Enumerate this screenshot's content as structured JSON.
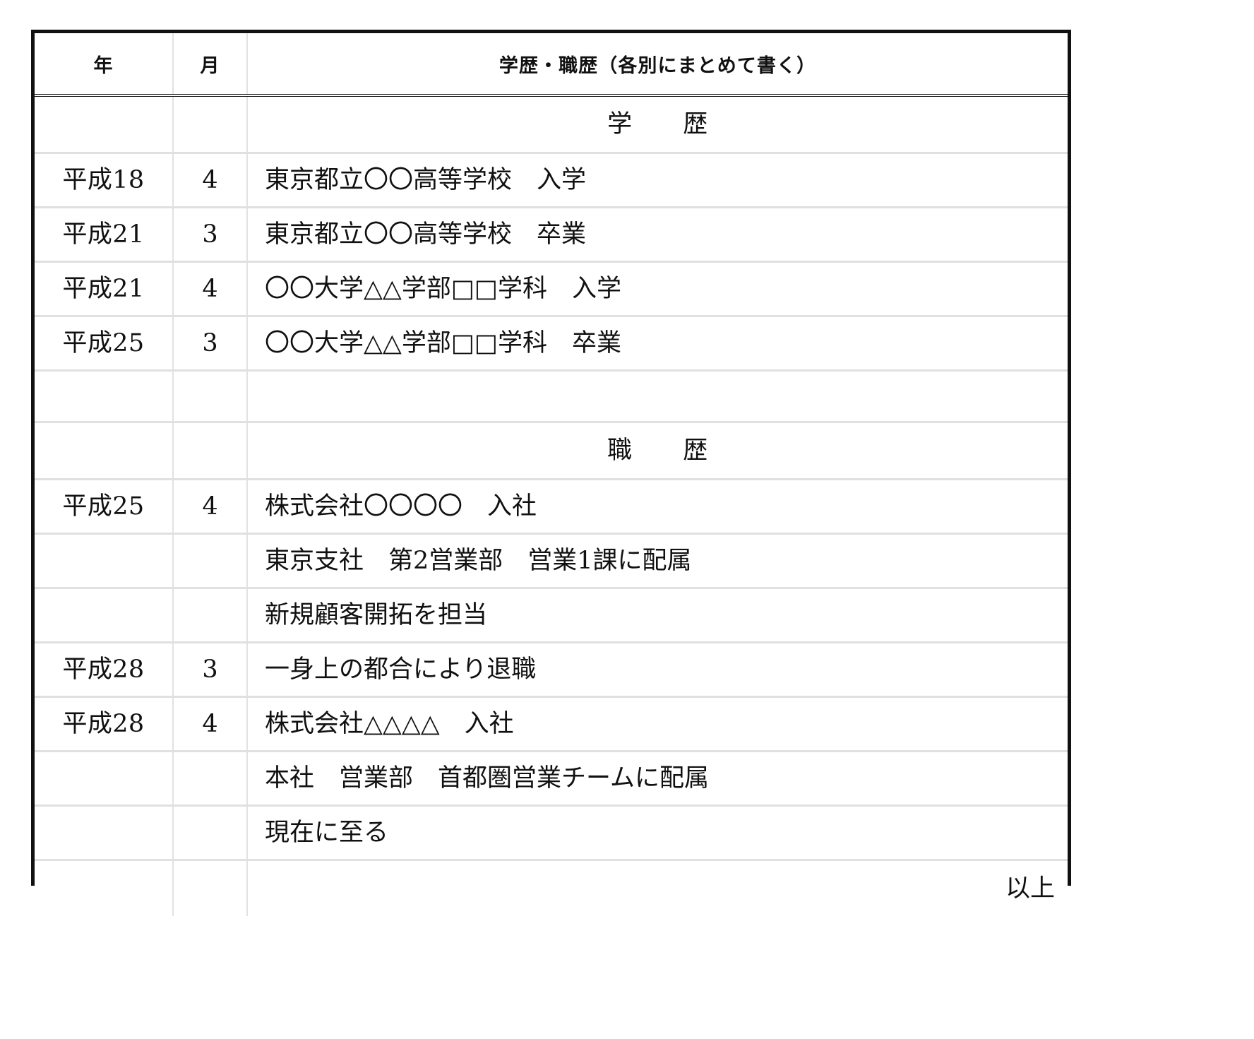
{
  "document": {
    "kind": "japanese-resume-history-table"
  },
  "table": {
    "headers": {
      "year": "年",
      "month": "月",
      "content": "学歴・職歴（各別にまとめて書く）"
    },
    "rows": [
      {
        "year": "",
        "month": "",
        "content": "学　　歴",
        "align": "center"
      },
      {
        "year": "平成18",
        "month": "4",
        "content": "東京都立〇〇高等学校　入学",
        "align": "left"
      },
      {
        "year": "平成21",
        "month": "3",
        "content": "東京都立〇〇高等学校　卒業",
        "align": "left"
      },
      {
        "year": "平成21",
        "month": "4",
        "content": "〇〇大学△△学部□□学科　入学",
        "align": "left"
      },
      {
        "year": "平成25",
        "month": "3",
        "content": "〇〇大学△△学部□□学科　卒業",
        "align": "left"
      },
      {
        "year": "",
        "month": "",
        "content": "",
        "align": "left"
      },
      {
        "year": "",
        "month": "",
        "content": "職　　歴",
        "align": "center"
      },
      {
        "year": "平成25",
        "month": "4",
        "content": "株式会社〇〇〇〇　入社",
        "align": "left"
      },
      {
        "year": "",
        "month": "",
        "content": "東京支社　第2営業部　営業1課に配属",
        "align": "left"
      },
      {
        "year": "",
        "month": "",
        "content": "新規顧客開拓を担当",
        "align": "left"
      },
      {
        "year": "平成28",
        "month": "3",
        "content": "一身上の都合により退職",
        "align": "left"
      },
      {
        "year": "平成28",
        "month": "4",
        "content": "株式会社△△△△　入社",
        "align": "left"
      },
      {
        "year": "",
        "month": "",
        "content": "本社　営業部　首都圏営業チームに配属",
        "align": "left"
      },
      {
        "year": "",
        "month": "",
        "content": "現在に至る",
        "align": "left"
      },
      {
        "year": "",
        "month": "",
        "content": "以上",
        "align": "right"
      }
    ]
  },
  "colors": {
    "ink": "#111111",
    "grid_light": "#e0e0e0",
    "page_background": "#ffffff"
  }
}
